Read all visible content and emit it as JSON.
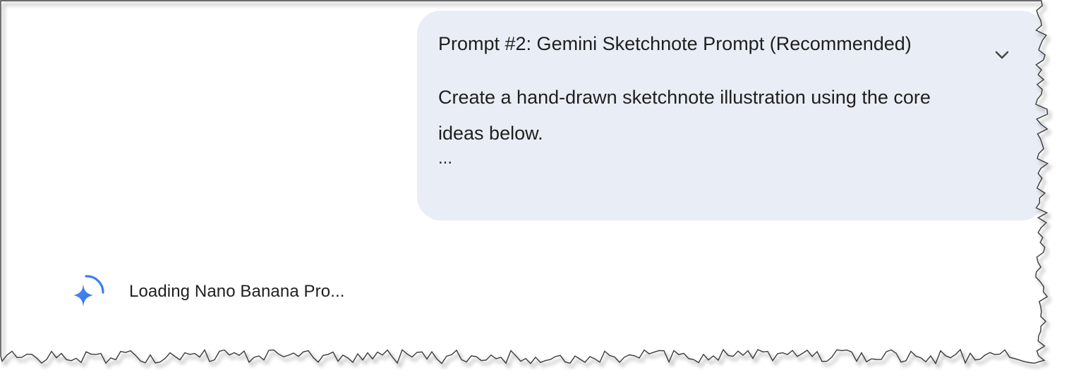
{
  "prompt_bubble": {
    "title": "Prompt #2: Gemini Sketchnote Prompt (Recommended)",
    "body": "Create a hand-drawn sketchnote illustration using the core ideas below.",
    "ellipsis": "...",
    "expand_icon": "chevron-down-icon"
  },
  "status": {
    "loading_text": "Loading Nano Banana Pro...",
    "icon": "gemini-spark-icon"
  },
  "colors": {
    "bubble_background": "#e9eef6",
    "text": "#1f1f1f",
    "spark_blue": "#4285f4"
  }
}
